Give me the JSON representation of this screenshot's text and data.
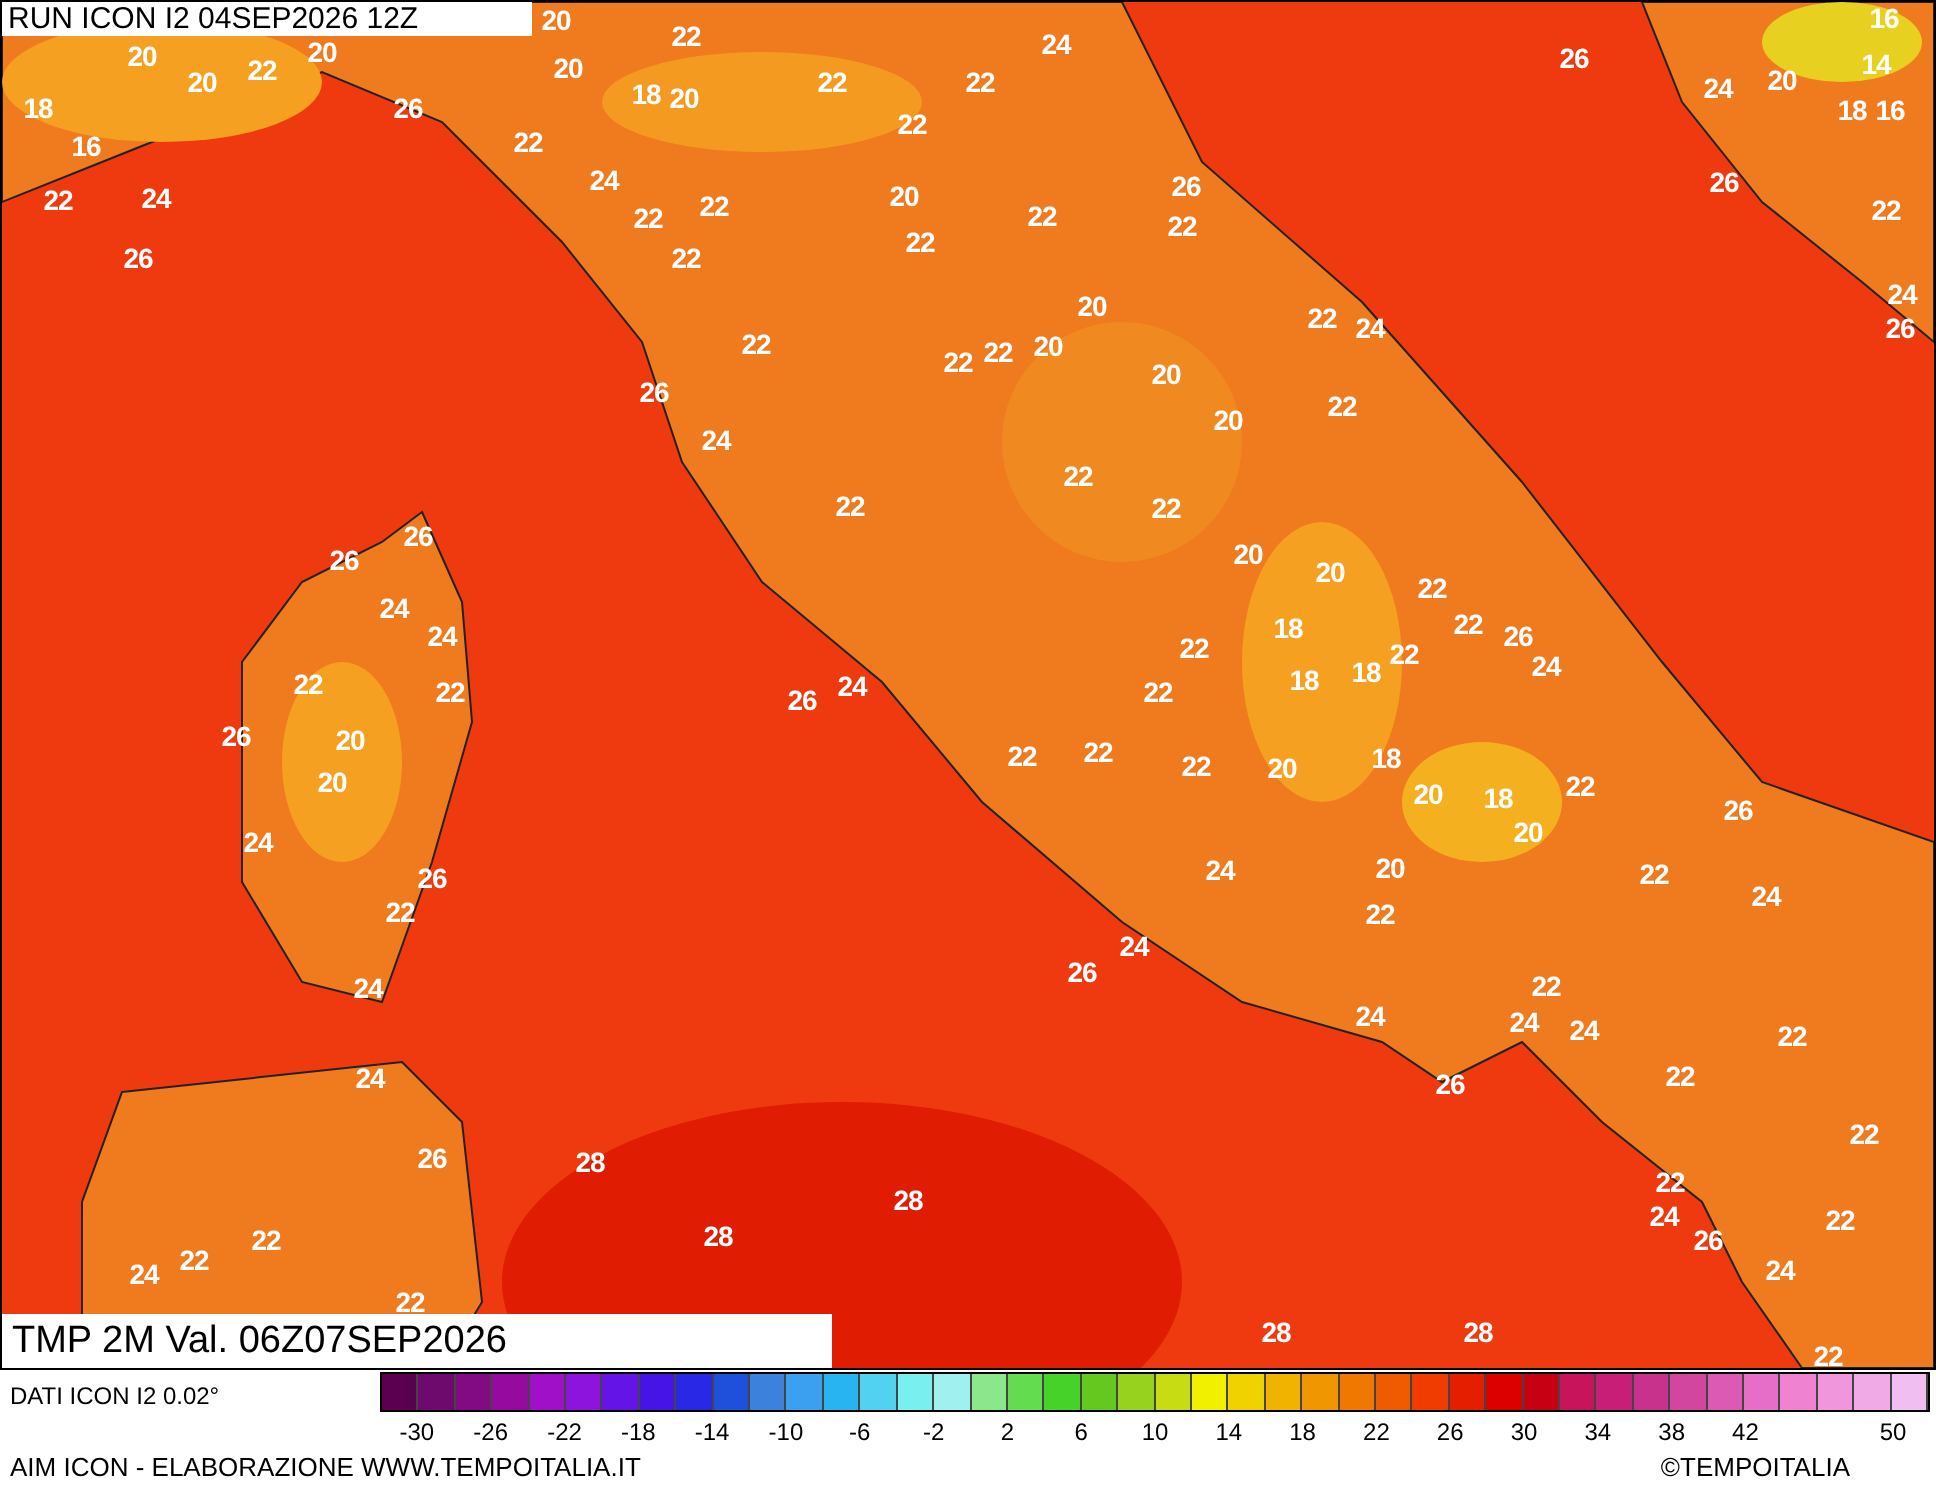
{
  "run_title": "RUN ICON I2 04SEP2026 12Z",
  "map": {
    "temperature_labels": [
      "20",
      "22",
      "24",
      "16",
      "20",
      "22",
      "20",
      "20",
      "26",
      "14",
      "20",
      "18",
      "20",
      "22",
      "22",
      "24",
      "20",
      "18",
      "26",
      "18",
      "16",
      "22",
      "22",
      "16",
      "22",
      "24",
      "24",
      "20",
      "26",
      "26",
      "22",
      "22",
      "22",
      "22",
      "22",
      "22",
      "26",
      "22",
      "24",
      "20",
      "22",
      "24",
      "26",
      "22",
      "22",
      "22",
      "20",
      "20",
      "26",
      "20",
      "22",
      "24",
      "22",
      "22",
      "22",
      "26",
      "26",
      "20",
      "20",
      "22",
      "24",
      "24",
      "22",
      "18",
      "22",
      "22",
      "26",
      "22",
      "22",
      "26",
      "24",
      "22",
      "18",
      "18",
      "24",
      "26",
      "20",
      "22",
      "22",
      "22",
      "20",
      "18",
      "20",
      "20",
      "18",
      "22",
      "26",
      "24",
      "20",
      "26",
      "24",
      "20",
      "22",
      "24",
      "22",
      "22",
      "24",
      "26",
      "24",
      "22",
      "24",
      "24",
      "24",
      "22",
      "24",
      "26",
      "22",
      "22",
      "26",
      "28",
      "22",
      "28",
      "22",
      "28",
      "24",
      "26",
      "22",
      "24",
      "22",
      "24",
      "22",
      "28",
      "28",
      "22"
    ]
  },
  "map_title": "TMP 2M Val. 06Z07SEP2026",
  "source_label": "DATI ICON I2 0.02°",
  "colorbar": {
    "swatches": [
      {
        "color": "#5a0050"
      },
      {
        "color": "#6e0a6e"
      },
      {
        "color": "#820a82"
      },
      {
        "color": "#960aa0"
      },
      {
        "color": "#a010c8"
      },
      {
        "color": "#8c14dc"
      },
      {
        "color": "#6414e6"
      },
      {
        "color": "#4614e6"
      },
      {
        "color": "#2828e6"
      },
      {
        "color": "#1e50dc"
      },
      {
        "color": "#3c82dc"
      },
      {
        "color": "#3ca0f0"
      },
      {
        "color": "#28b4f0"
      },
      {
        "color": "#50d2f0"
      },
      {
        "color": "#78f0f0"
      },
      {
        "color": "#a0f0f0"
      },
      {
        "color": "#8ce68c"
      },
      {
        "color": "#64dc50"
      },
      {
        "color": "#46d228"
      },
      {
        "color": "#64c81e"
      },
      {
        "color": "#96d21e"
      },
      {
        "color": "#c8dc14"
      },
      {
        "color": "#f0f000"
      },
      {
        "color": "#f0d200"
      },
      {
        "color": "#f0b400"
      },
      {
        "color": "#f09600"
      },
      {
        "color": "#f07800"
      },
      {
        "color": "#f05a00"
      },
      {
        "color": "#f03c00"
      },
      {
        "color": "#e61e00"
      },
      {
        "color": "#dc0000"
      },
      {
        "color": "#c80014"
      },
      {
        "color": "#c8145a"
      },
      {
        "color": "#c81e78"
      },
      {
        "color": "#c8328c"
      },
      {
        "color": "#d246a0"
      },
      {
        "color": "#dc5ab4"
      },
      {
        "color": "#e66ec8"
      },
      {
        "color": "#f082d2"
      },
      {
        "color": "#f096dc"
      },
      {
        "color": "#f0aae6"
      },
      {
        "color": "#f0bef0"
      }
    ],
    "ticks": [
      "-30",
      "-26",
      "-22",
      "-18",
      "-14",
      "-10",
      "-6",
      "-2",
      "2",
      "6",
      "10",
      "14",
      "18",
      "22",
      "26",
      "30",
      "34",
      "38",
      "42",
      "50"
    ]
  },
  "footer_left": "AIM ICON - ELABORAZIONE WWW.TEMPOITALIA.IT",
  "footer_right": "©TEMPOITALIA"
}
